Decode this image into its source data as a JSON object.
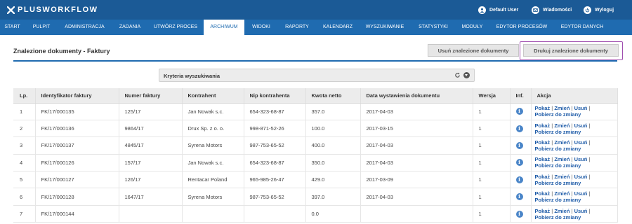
{
  "app": {
    "logo_text": "PLUSWORKFLOW",
    "topbar": {
      "user": "Default User",
      "messages": "Wiadomości",
      "logout": "Wyloguj"
    }
  },
  "colors": {
    "topbar_bg": "#1b5a96",
    "menubar_bg": "#1f6bb0",
    "accent_outline": "#a050b0",
    "link": "#1f5ca8"
  },
  "menu": {
    "items": [
      {
        "label": "START"
      },
      {
        "label": "PULPIT"
      },
      {
        "label": "ADMINISTRACJA"
      },
      {
        "label": "ZADANIA"
      },
      {
        "label": "UTWÓRZ PROCES"
      },
      {
        "label": "ARCHIWUM",
        "active": true
      },
      {
        "label": "WIDOKI"
      },
      {
        "label": "RAPORTY"
      },
      {
        "label": "KALENDARZ"
      },
      {
        "label": "WYSZUKIWANIE"
      },
      {
        "label": "STATYSTYKI"
      },
      {
        "label": "MODUŁY"
      },
      {
        "label": "EDYTOR PROCESÓW"
      },
      {
        "label": "EDYTOR DANYCH"
      }
    ]
  },
  "page": {
    "title": "Znalezione dokumenty - Faktury",
    "remove_button": "Usuń znalezione dokumenty",
    "print_button": "Drukuj znalezione dokumenty",
    "criteria_label": "Kryteria wyszukiwania"
  },
  "table": {
    "headers": {
      "lp": "Lp.",
      "id": "Identyfikator faktury",
      "number": "Numer faktury",
      "contractor": "Kontrahent",
      "nip": "Nip kontrahenta",
      "amount": "Kwota netto",
      "date": "Data wystawienia dokumentu",
      "version": "Wersja",
      "info": "Inf.",
      "action": "Akcja"
    },
    "action_labels": {
      "show": "Pokaż",
      "change": "Zmień",
      "delete": "Usuń",
      "download": "Pobierz do zmiany",
      "sep": "|"
    },
    "info_glyph": "i",
    "rows": [
      {
        "lp": "1",
        "id": "FK/17/000135",
        "number": "125/17",
        "contractor": "Jan Nowak s.c.",
        "nip": "654-323-68-87",
        "amount": "357.0",
        "date": "2017-04-03",
        "version": "1"
      },
      {
        "lp": "2",
        "id": "FK/17/000136",
        "number": "9864/17",
        "contractor": "Drux Sp. z o. o.",
        "nip": "998-871-52-26",
        "amount": "100.0",
        "date": "2017-03-15",
        "version": "1"
      },
      {
        "lp": "3",
        "id": "FK/17/000137",
        "number": "4845/17",
        "contractor": "Syrena Motors",
        "nip": "987-753-65-52",
        "amount": "400.0",
        "date": "2017-04-03",
        "version": "1"
      },
      {
        "lp": "4",
        "id": "FK/17/000126",
        "number": "157/17",
        "contractor": "Jan Nowak s.c.",
        "nip": "654-323-68-87",
        "amount": "350.0",
        "date": "2017-04-03",
        "version": "1"
      },
      {
        "lp": "5",
        "id": "FK/17/000127",
        "number": "126/17",
        "contractor": "Rentacar Poland",
        "nip": "965-985-26-47",
        "amount": "429.0",
        "date": "2017-03-09",
        "version": "1"
      },
      {
        "lp": "6",
        "id": "FK/17/000128",
        "number": "1647/17",
        "contractor": "Syrena Motors",
        "nip": "987-753-65-52",
        "amount": "397.0",
        "date": "2017-04-03",
        "version": "1"
      },
      {
        "lp": "7",
        "id": "FK/17/000144",
        "number": "",
        "contractor": "",
        "nip": "",
        "amount": "0.0",
        "date": "",
        "version": "1"
      }
    ]
  }
}
